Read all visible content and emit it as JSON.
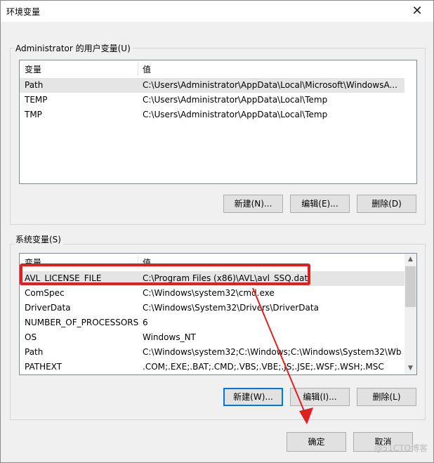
{
  "window": {
    "title": "环境变量",
    "close_glyph": "✕"
  },
  "user_vars": {
    "group_label": "Administrator 的用户变量(U)",
    "col_variable": "变量",
    "col_value": "值",
    "rows": [
      {
        "name": "Path",
        "value": "C:\\Users\\Administrator\\AppData\\Local\\Microsoft\\WindowsA..."
      },
      {
        "name": "TEMP",
        "value": "C:\\Users\\Administrator\\AppData\\Local\\Temp"
      },
      {
        "name": "TMP",
        "value": "C:\\Users\\Administrator\\AppData\\Local\\Temp"
      }
    ],
    "buttons": {
      "new": "新建(N)...",
      "edit": "编辑(E)...",
      "delete": "删除(D)"
    }
  },
  "system_vars": {
    "group_label": "系统变量(S)",
    "col_variable": "变量",
    "col_value": "值",
    "rows": [
      {
        "name": "AVL_LICENSE_FILE",
        "value": "C:\\Program Files (x86)\\AVL\\avl_SSQ.dat"
      },
      {
        "name": "ComSpec",
        "value": "C:\\Windows\\system32\\cmd.exe"
      },
      {
        "name": "DriverData",
        "value": "C:\\Windows\\System32\\Drivers\\DriverData"
      },
      {
        "name": "NUMBER_OF_PROCESSORS",
        "value": "6"
      },
      {
        "name": "OS",
        "value": "Windows_NT"
      },
      {
        "name": "Path",
        "value": "C:\\Windows\\system32;C:\\Windows;C:\\Windows\\System32\\Wb..."
      },
      {
        "name": "PATHEXT",
        "value": ".COM;.EXE;.BAT;.CMD;.VBS;.VBE;.JS;.JSE;.WSF;.WSH;.MSC"
      }
    ],
    "buttons": {
      "new": "新建(W)...",
      "edit": "编辑(I)...",
      "delete": "删除(L)"
    }
  },
  "footer": {
    "ok": "确定",
    "cancel": "取消"
  },
  "watermark": "@51CTO博客",
  "annotation_color": "#e02020"
}
